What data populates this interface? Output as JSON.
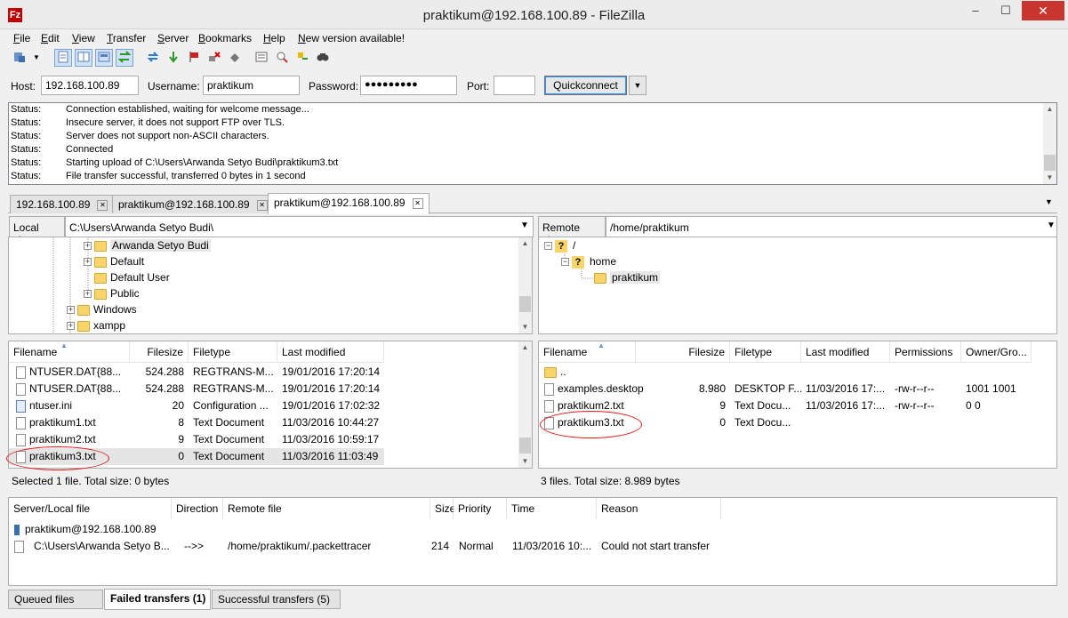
{
  "window": {
    "title": "praktikum@192.168.100.89 - FileZilla",
    "app_icon": "Fz",
    "minimize": "–",
    "maximize": "☐",
    "close": "✕"
  },
  "menu": [
    "File",
    "Edit",
    "View",
    "Transfer",
    "Server",
    "Bookmarks",
    "Help",
    "New version available!"
  ],
  "toolbar": {
    "icons": [
      "site-manager-icon",
      "dropdown-icon",
      "toggle-log-icon",
      "toggle-local-tree-icon",
      "toggle-remote-tree-icon",
      "toggle-queue-icon",
      "refresh-icon",
      "process-queue-icon",
      "cancel-icon",
      "disconnect-icon",
      "reconnect-icon",
      "compare-icon",
      "filter-icon",
      "sync-browse-icon",
      "find-icon"
    ]
  },
  "quickconnect": {
    "host_label": "Host:",
    "host": "192.168.100.89",
    "username_label": "Username:",
    "username": "praktikum",
    "password_label": "Password:",
    "password": "●●●●●●●●●",
    "port_label": "Port:",
    "port": "",
    "button": "Quickconnect",
    "dropdown": "▼"
  },
  "log": [
    {
      "label": "Status:",
      "text": "Connection established, waiting for welcome message..."
    },
    {
      "label": "Status:",
      "text": "Insecure server, it does not support FTP over TLS."
    },
    {
      "label": "Status:",
      "text": "Server does not support non-ASCII characters."
    },
    {
      "label": "Status:",
      "text": "Connected"
    },
    {
      "label": "Status:",
      "text": "Starting upload of C:\\Users\\Arwanda Setyo Budi\\praktikum3.txt"
    },
    {
      "label": "Status:",
      "text": "File transfer successful, transferred 0 bytes in 1 second"
    }
  ],
  "tabs": [
    {
      "label": "192.168.100.89",
      "close": "✕"
    },
    {
      "label": "praktikum@192.168.100.89",
      "close": "✕"
    },
    {
      "label": "praktikum@192.168.100.89",
      "close": "✕"
    }
  ],
  "local": {
    "site_label": "Local site:",
    "path": "C:\\Users\\Arwanda Setyo Budi\\",
    "tree": [
      "Arwanda Setyo Budi",
      "Default",
      "Default User",
      "Public",
      "Windows",
      "xampp"
    ],
    "columns": [
      "Filename",
      "Filesize",
      "Filetype",
      "Last modified"
    ],
    "files": [
      {
        "name": "NTUSER.DAT{88...",
        "size": "524.288",
        "type": "REGTRANS-M...",
        "modified": "19/01/2016 17:20:14"
      },
      {
        "name": "NTUSER.DAT{88...",
        "size": "524.288",
        "type": "REGTRANS-M...",
        "modified": "19/01/2016 17:20:14"
      },
      {
        "name": "ntuser.ini",
        "size": "20",
        "type": "Configuration ...",
        "modified": "19/01/2016 17:02:32"
      },
      {
        "name": "praktikum1.txt",
        "size": "8",
        "type": "Text Document",
        "modified": "11/03/2016 10:44:27"
      },
      {
        "name": "praktikum2.txt",
        "size": "9",
        "type": "Text Document",
        "modified": "11/03/2016 10:59:17"
      },
      {
        "name": "praktikum3.txt",
        "size": "0",
        "type": "Text Document",
        "modified": "11/03/2016 11:03:49"
      }
    ],
    "status": "Selected 1 file. Total size: 0 bytes"
  },
  "remote": {
    "site_label": "Remote site:",
    "path": "/home/praktikum",
    "tree": [
      "/",
      "home",
      "praktikum"
    ],
    "columns": [
      "Filename",
      "Filesize",
      "Filetype",
      "Last modified",
      "Permissions",
      "Owner/Gro..."
    ],
    "files": [
      {
        "name": "..",
        "size": "",
        "type": "",
        "modified": "",
        "perms": "",
        "owner": ""
      },
      {
        "name": "examples.desktop",
        "size": "8.980",
        "type": "DESKTOP F...",
        "modified": "11/03/2016 17:...",
        "perms": "-rw-r--r--",
        "owner": "1001 1001"
      },
      {
        "name": "praktikum2.txt",
        "size": "9",
        "type": "Text Docu...",
        "modified": "11/03/2016 17:...",
        "perms": "-rw-r--r--",
        "owner": "0 0"
      },
      {
        "name": "praktikum3.txt",
        "size": "0",
        "type": "Text Docu...",
        "modified": "",
        "perms": "",
        "owner": ""
      }
    ],
    "status": "3 files. Total size: 8.989 bytes"
  },
  "queue": {
    "columns": [
      "Server/Local file",
      "Direction",
      "Remote file",
      "Size",
      "Priority",
      "Time",
      "Reason"
    ],
    "server": "praktikum@192.168.100.89",
    "item": {
      "local": "C:\\Users\\Arwanda Setyo B...",
      "direction": "-->>",
      "remote": "/home/praktikum/.packettracer",
      "size": "214",
      "priority": "Normal",
      "time": "11/03/2016 10:...",
      "reason": "Could not start transfer"
    }
  },
  "bottom_tabs": [
    "Queued files",
    "Failed transfers (1)",
    "Successful transfers (5)"
  ],
  "colors": {
    "annotation": "#e01b1b",
    "close_button": "#c7372f"
  }
}
